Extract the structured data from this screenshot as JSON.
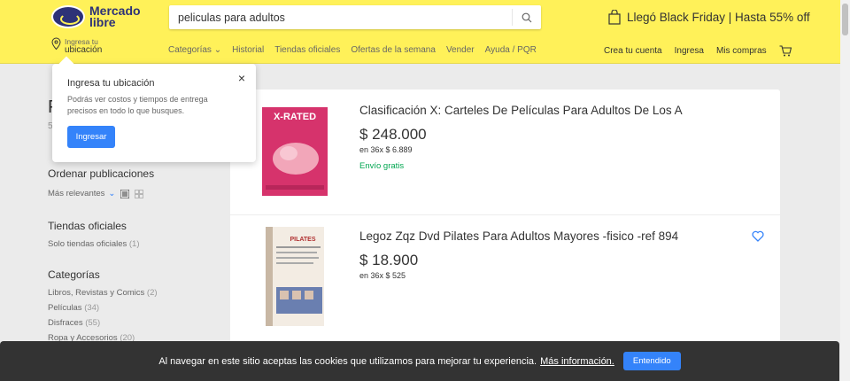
{
  "header": {
    "logo_line1": "Mercado",
    "logo_line2": "libre",
    "search_value": "peliculas para adultos",
    "promo_text": "Llegó Black Friday | Hasta 55% off",
    "location_small": "Ingresa tu",
    "location_big": "ubicación",
    "nav": [
      "Categorías ⌄",
      "Historial",
      "Tiendas oficiales",
      "Ofertas de la semana",
      "Vender",
      "Ayuda / PQR"
    ],
    "user_nav": [
      "Crea tu cuenta",
      "Ingresa",
      "Mis compras"
    ],
    "brand_color": "#fff159"
  },
  "popup": {
    "title": "Ingresa tu ubicación",
    "body": "Podrás ver costos y tiempos de entrega precisos en todo lo que busques.",
    "button": "Ingresar",
    "close": "×"
  },
  "sidebar": {
    "title_fragment": "P",
    "subtitle_fragment": "58",
    "sort_title": "Ordenar publicaciones",
    "sort_value": "Más relevantes",
    "stores_title": "Tiendas oficiales",
    "stores_item": {
      "label": "Solo tiendas oficiales",
      "count": "(1)"
    },
    "categories_title": "Categorías",
    "categories": [
      {
        "label": "Libros, Revistas y Comics",
        "count": "(2)"
      },
      {
        "label": "Películas",
        "count": "(34)"
      },
      {
        "label": "Disfraces",
        "count": "(55)"
      },
      {
        "label": "Ropa y Accesorios",
        "count": "(20)"
      }
    ]
  },
  "results": [
    {
      "title": "Clasificación X: Carteles De Películas Para Adultos De Los A",
      "price": "$ 248.000",
      "installments": "en 36x $ 6.889",
      "shipping": "Envío gratis",
      "thumb_label": "X-RATED"
    },
    {
      "title": "Legoz Zqz Dvd Pilates Para Adultos Mayores -fisico -ref 894",
      "price": "$ 18.900",
      "installments": "en 36x $ 525",
      "shipping": "",
      "thumb_label": "PILATES"
    }
  ],
  "cookie": {
    "text": "Al navegar en este sitio aceptas las cookies que utilizamos para mejorar tu experiencia.",
    "link": "Más información.",
    "button": "Entendido"
  },
  "colors": {
    "accent": "#3483fa",
    "shipping": "#00a650",
    "banner": "#333333"
  }
}
